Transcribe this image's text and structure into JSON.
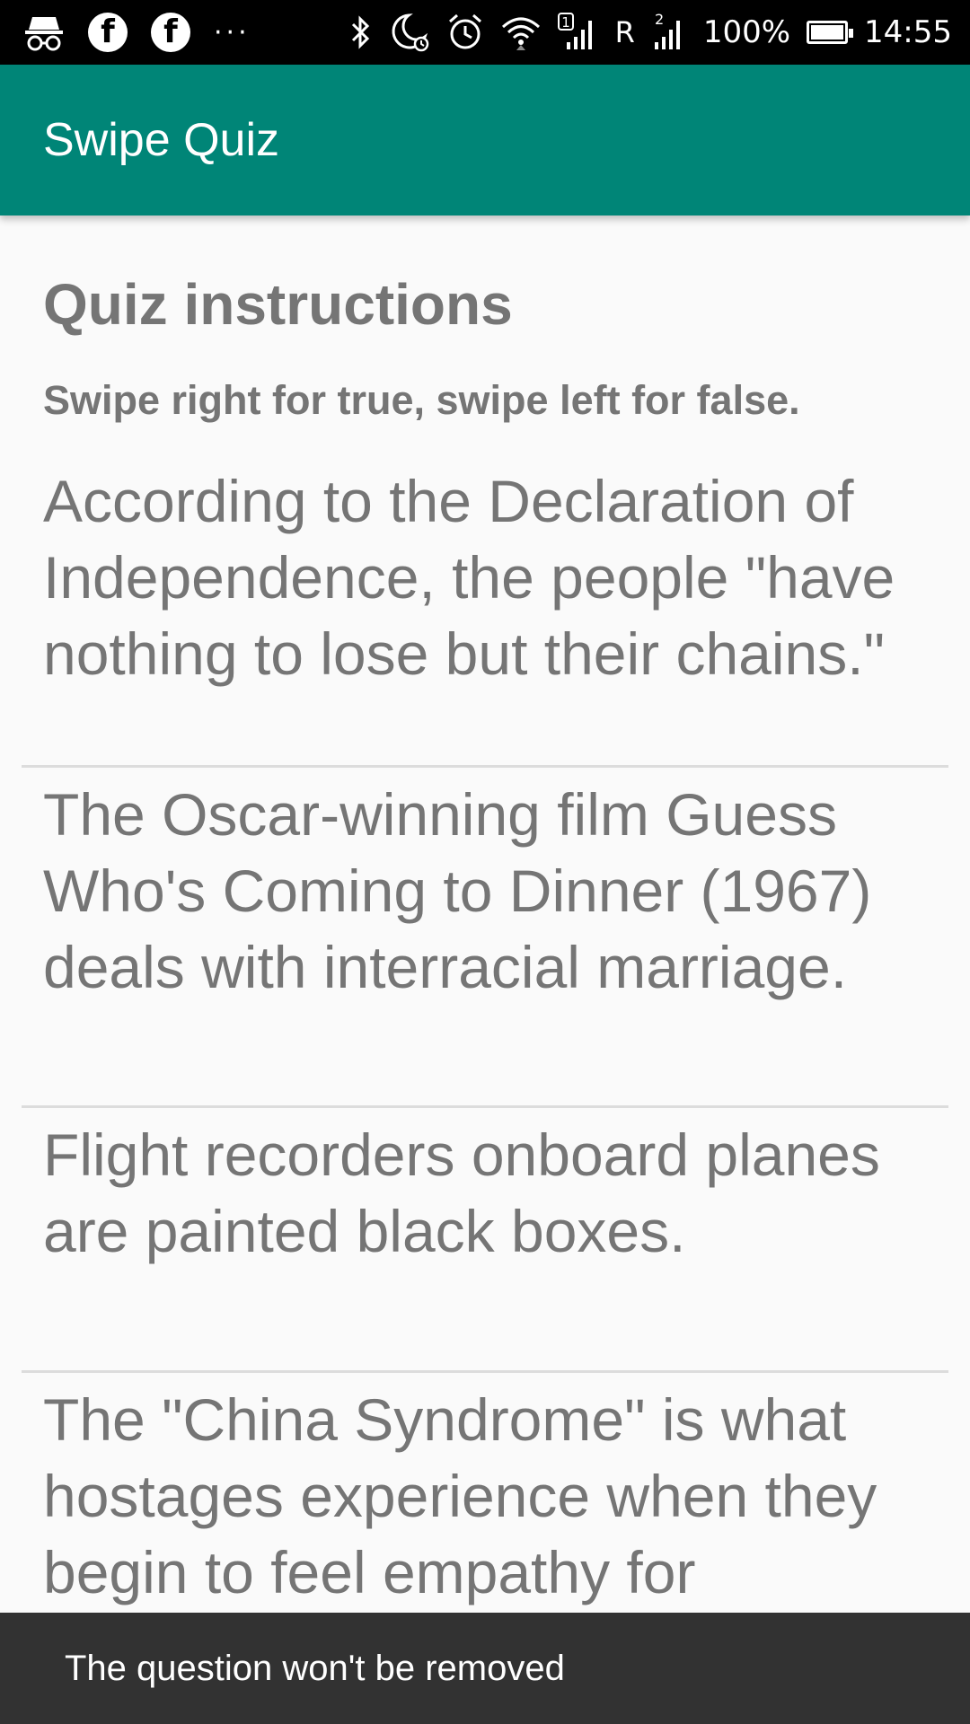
{
  "status_bar": {
    "left_icons": [
      "incognito-icon",
      "facebook-icon",
      "facebook-icon",
      "more-notifications-icon"
    ],
    "more_text": "···",
    "sim1_label": "1",
    "roaming": "R",
    "sim2_label": "2",
    "battery_percent": "100%",
    "battery_level": 1.0,
    "time": "14:55"
  },
  "app_bar": {
    "title": "Swipe Quiz",
    "color": "#008577"
  },
  "instructions": {
    "heading": "Quiz instructions",
    "subheading": "Swipe right for true, swipe left for false."
  },
  "questions": [
    "According to the Declaration of Independence, the people \"have nothing to lose but their chains.\"",
    "The Oscar-winning film Guess Who's Coming to Dinner (1967) deals with interracial marriage.",
    "Flight recorders onboard planes are painted black boxes.",
    "The \"China Syndrome\" is what hostages experience when they begin to feel empathy for"
  ],
  "snackbar": {
    "message": "The question won't be removed"
  }
}
